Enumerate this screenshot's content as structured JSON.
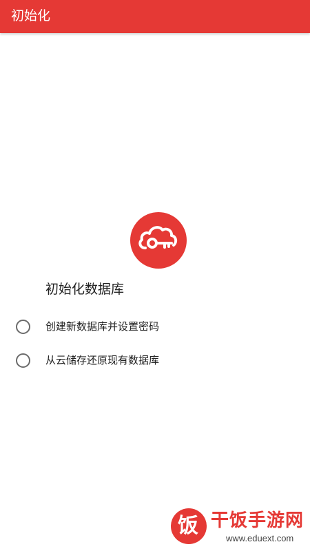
{
  "app_bar": {
    "title": "初始化"
  },
  "logo": {
    "icon": "cloud-key-icon",
    "color": "#e53935"
  },
  "heading": "初始化数据库",
  "options": [
    {
      "label": "创建新数据库并设置密码",
      "selected": false
    },
    {
      "label": "从云储存还原现有数据库",
      "selected": false
    }
  ],
  "watermark": {
    "glyph": "饭",
    "title": "干饭手游网",
    "url": "www.eduext.com"
  },
  "colors": {
    "accent": "#e53935",
    "text": "#222222",
    "radio_border": "#6b6b6b"
  }
}
